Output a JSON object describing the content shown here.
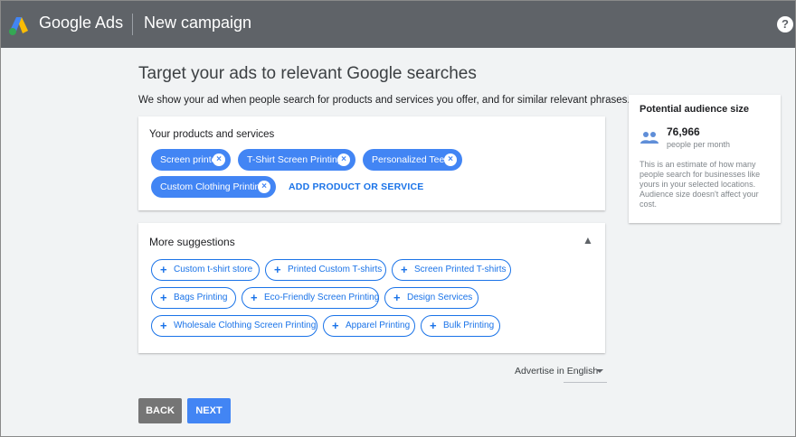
{
  "header": {
    "brand": "Google Ads",
    "page_title": "New campaign",
    "help_icon": "help-circle-icon"
  },
  "main": {
    "title": "Target your ads to relevant Google searches",
    "subtitle": "We show your ad when people search for products and services you offer, and for similar relevant phrases."
  },
  "products": {
    "title": "Your products and services",
    "chips": [
      "Screen printer",
      "T-Shirt Screen Printing",
      "Personalized Tees",
      "Custom Clothing Printing"
    ],
    "add_label": "ADD PRODUCT OR SERVICE",
    "chip_color": "#4285f4"
  },
  "suggestions": {
    "title": "More suggestions",
    "items": [
      "Custom t-shirt store",
      "Printed Custom T-shirts",
      "Screen Printed T-shirts",
      "Bags Printing",
      "Eco-Friendly Screen Printing",
      "Design Services",
      "Wholesale Clothing Screen Printing",
      "Apparel Printing",
      "Bulk Printing"
    ]
  },
  "audience": {
    "title": "Potential audience size",
    "count": "76,966",
    "unit": "people per month",
    "description": "This is an estimate of how many people search for businesses like yours in your selected locations. Audience size doesn't affect your cost."
  },
  "language": {
    "label": "Advertise in English"
  },
  "buttons": {
    "back": "BACK",
    "next": "NEXT"
  },
  "colors": {
    "topbar": "#5f6368",
    "accent": "#4285f4",
    "link": "#1a73e8"
  }
}
